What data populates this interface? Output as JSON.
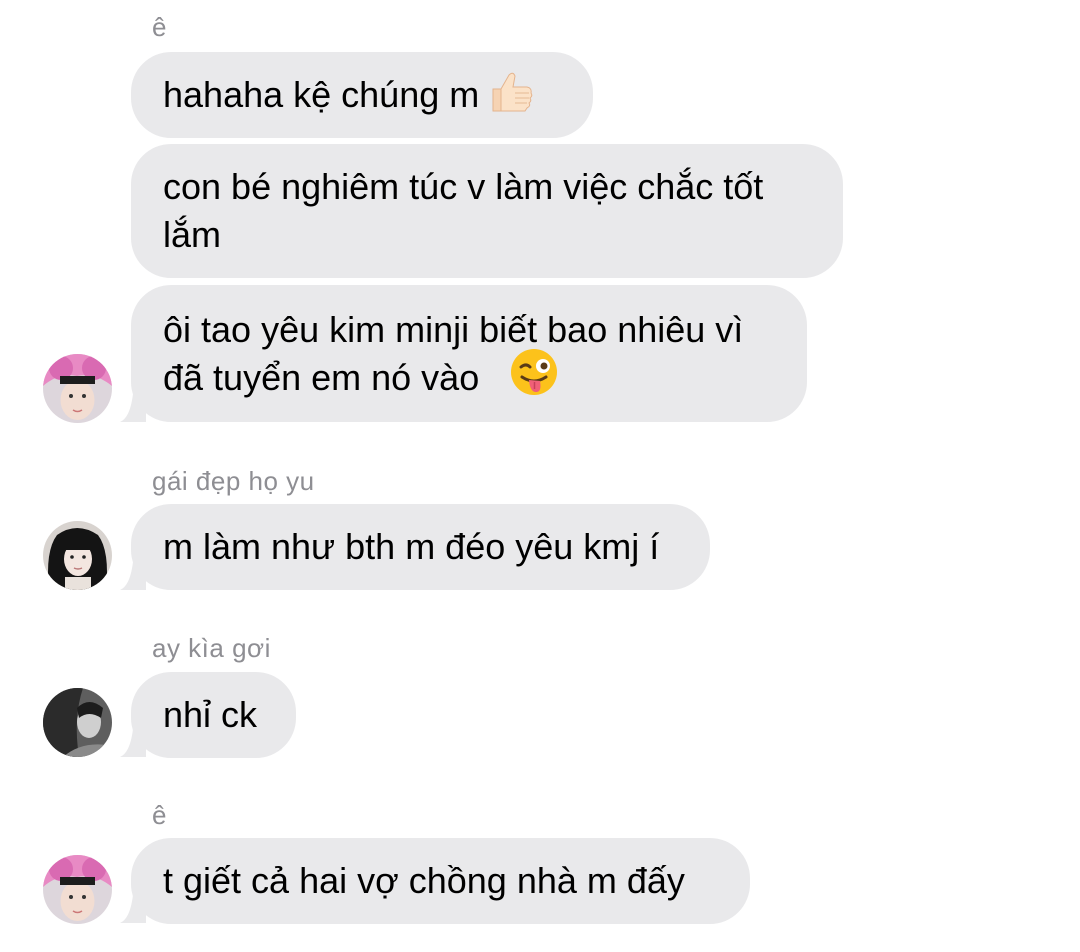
{
  "groups": [
    {
      "sender": "ê",
      "messages": [
        {
          "text": "hahaha kệ chúng m",
          "emoji": "thumbs-up-emoji"
        },
        {
          "text": "con bé nghiêm túc v làm việc chắc tốt lắm"
        },
        {
          "text": "ôi tao yêu kim minji biết bao nhiêu vì đã tuyển em nó vào",
          "emoji": "winking-face-with-tongue-emoji"
        }
      ]
    },
    {
      "sender": "gái đẹp họ yu",
      "messages": [
        {
          "text": "m làm như bth m đéo yêu kmj í"
        }
      ]
    },
    {
      "sender": "ay kìa gơi",
      "messages": [
        {
          "text": "nhỉ ck"
        }
      ]
    },
    {
      "sender": "ê",
      "messages": [
        {
          "text": "t giết cả hai vợ chồng nhà m đấy"
        }
      ]
    }
  ],
  "colors": {
    "bubble": "#e9e9eb",
    "sender_name": "#8e8e93",
    "message_text": "#000000"
  }
}
